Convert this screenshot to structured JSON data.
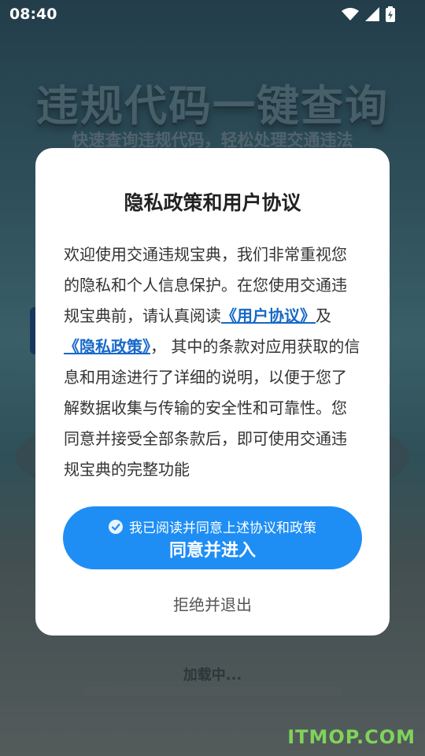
{
  "status_bar": {
    "time": "08:40",
    "icons": [
      "wifi-icon",
      "signal-icon",
      "battery-charging-icon"
    ]
  },
  "background": {
    "title": "违规代码一键查询",
    "subtitle": "快速查询违规代码，轻松处理交通违法",
    "loading": "加载中..."
  },
  "dialog": {
    "title": "隐私政策和用户协议",
    "body_part1": "欢迎使用交通违规宝典，我们非常重视您的隐私和个人信息保护。在您使用交通违规宝典前，请认真阅读",
    "user_agreement_link": "《用户协议》",
    "and": "及",
    "privacy_policy_link": "《隐私政策》",
    "body_part2": "， 其中的条款对应用获取的信息和用途进行了详细的说明，以便于您了解数据收集与传输的安全性和可靠性。您同意并接受全部条款后，即可使用交通违规宝典的完整功能",
    "agree_check_label": "我已阅读并同意上述协议和政策",
    "agree_button_label": "同意并进入",
    "reject_label": "拒绝并退出"
  },
  "watermark": "ITMOP.COM",
  "colors": {
    "primary": "#1e8ef5",
    "link": "#1768c8",
    "watermark": "#7fd35a"
  }
}
